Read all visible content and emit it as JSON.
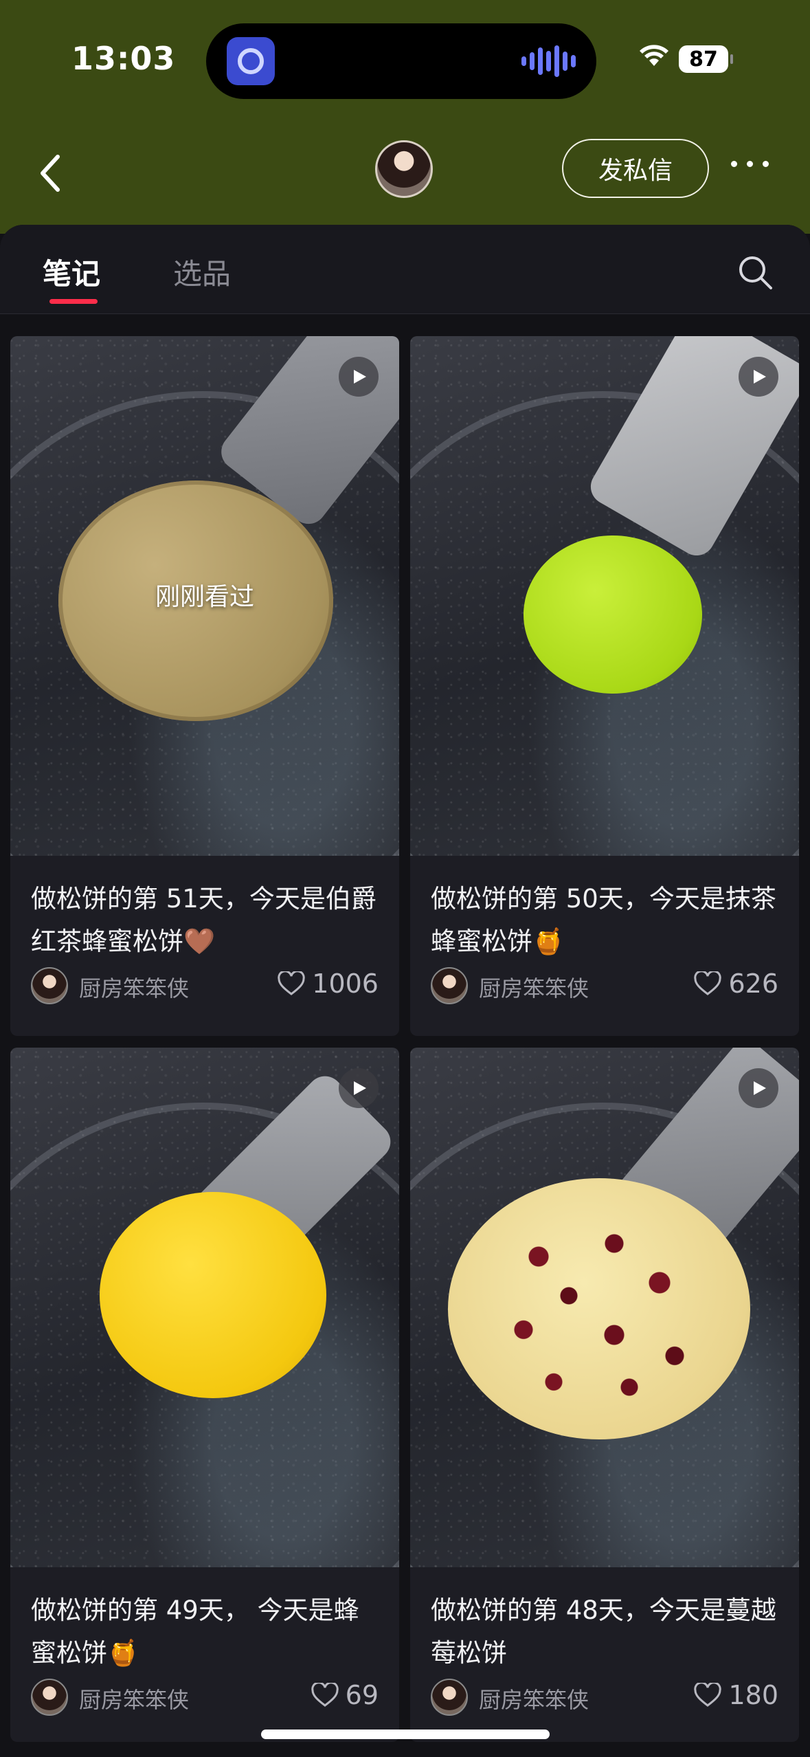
{
  "status_bar": {
    "time": "13:03",
    "battery": "87"
  },
  "header": {
    "dm_label": "发私信"
  },
  "tabs": [
    {
      "label": "笔记",
      "active": true
    },
    {
      "label": "选品",
      "active": false
    }
  ],
  "notes": [
    {
      "title": "做松饼的第 51天，今天是伯爵红茶蜂蜜松饼🤎",
      "author": "厨房笨笨侠",
      "likes": "1006",
      "overlay": "刚刚看过"
    },
    {
      "title": "做松饼的第 50天，今天是抹茶蜂蜜松饼🍯",
      "author": "厨房笨笨侠",
      "likes": "626"
    },
    {
      "title": "做松饼的第 49天， 今天是蜂蜜松饼🍯",
      "author": "厨房笨笨侠",
      "likes": "69"
    },
    {
      "title": "做松饼的第 48天，今天是蔓越莓松饼",
      "author": "厨房笨笨侠",
      "likes": "180"
    }
  ],
  "colors": {
    "header_bg": "#3b4a13",
    "tab_indicator": "#ff2d4a",
    "page_bg": "#121216",
    "card_bg": "#1d1d24"
  }
}
